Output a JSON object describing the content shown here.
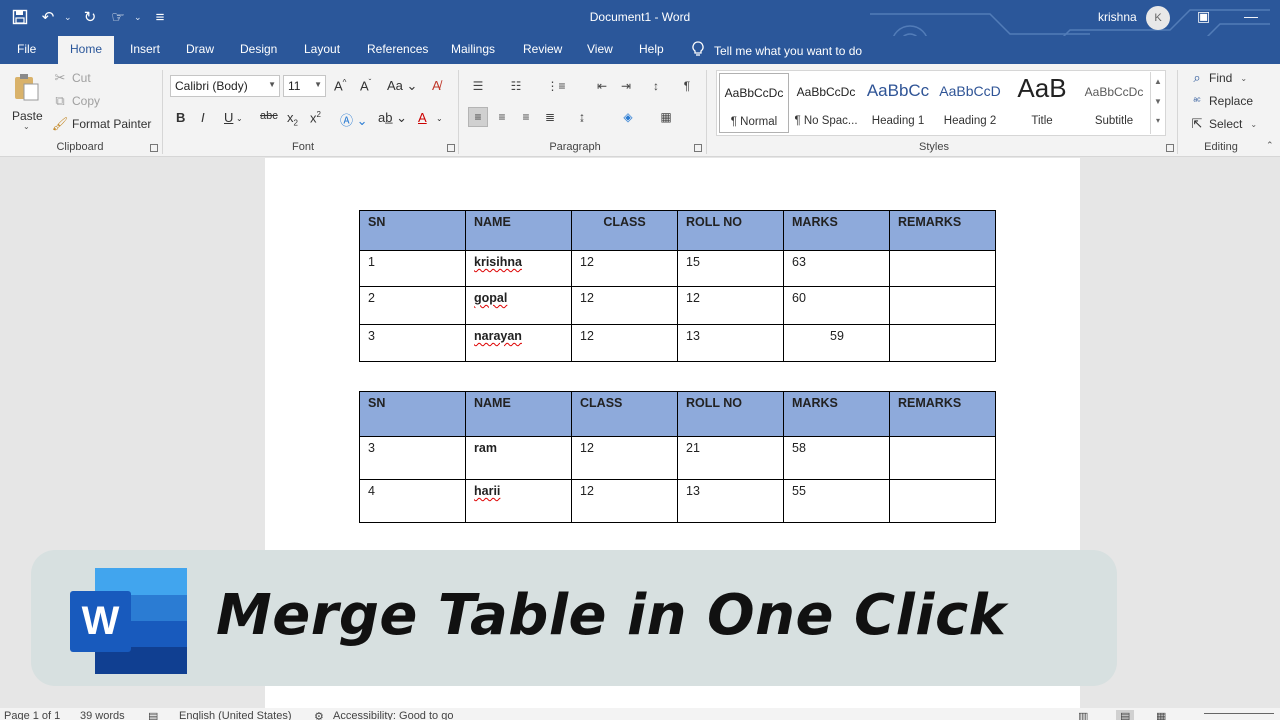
{
  "titlebar": {
    "doc_title": "Document1  -  Word",
    "user_name": "krishna",
    "avatar_initial": "K"
  },
  "tabs": {
    "file": "File",
    "home": "Home",
    "insert": "Insert",
    "draw": "Draw",
    "design": "Design",
    "layout": "Layout",
    "references": "References",
    "mailings": "Mailings",
    "review": "Review",
    "view": "View",
    "help": "Help",
    "tell_me": "Tell me what you want to do"
  },
  "clipboard": {
    "paste": "Paste",
    "cut": "Cut",
    "copy": "Copy",
    "format_painter": "Format Painter",
    "label": "Clipboard"
  },
  "font": {
    "font_name": "Calibri (Body)",
    "font_size": "11",
    "label": "Font"
  },
  "paragraph": {
    "label": "Paragraph"
  },
  "styles": {
    "label": "Styles",
    "items": [
      {
        "preview": "AaBbCcDc",
        "name": "¶ Normal"
      },
      {
        "preview": "AaBbCcDc",
        "name": "¶ No Spac..."
      },
      {
        "preview": "AaBbCc",
        "name": "Heading 1"
      },
      {
        "preview": "AaBbCcD",
        "name": "Heading 2"
      },
      {
        "preview": "AaB",
        "name": "Title"
      },
      {
        "preview": "AaBbCcDc",
        "name": "Subtitle"
      }
    ]
  },
  "editing": {
    "find": "Find",
    "replace": "Replace",
    "select": "Select",
    "label": "Editing"
  },
  "table1": {
    "headers": [
      "SN",
      "NAME",
      "CLASS",
      "ROLL NO",
      "MARKS",
      "REMARKS"
    ],
    "rows": [
      [
        "1",
        "krisihna",
        "12",
        "15",
        "63",
        ""
      ],
      [
        "2",
        "gopal",
        "12",
        "12",
        "60",
        ""
      ],
      [
        "3",
        "narayan",
        "12",
        "13",
        "59",
        ""
      ]
    ]
  },
  "table2": {
    "headers": [
      "SN",
      "NAME",
      "CLASS",
      "ROLL NO",
      "MARKS",
      "REMARKS"
    ],
    "rows": [
      [
        "3",
        "ram",
        "12",
        "21",
        "58",
        ""
      ],
      [
        "4",
        "harii",
        "12",
        "13",
        "55",
        ""
      ]
    ]
  },
  "banner": {
    "logo_letter": "W",
    "title": "Merge Table in One Click"
  },
  "statusbar": {
    "page": "Page 1 of 1",
    "words": "39 words",
    "language": "English (United States)",
    "accessibility": "Accessibility: Good to go"
  },
  "icons": [
    "save-icon",
    "undo-icon",
    "redo-icon",
    "touch-mode-icon",
    "customize-qat-icon",
    "ribbon-display-icon",
    "minimize-icon",
    "lightbulb-icon",
    "paste-icon",
    "cut-icon",
    "copy-icon",
    "format-painter-icon",
    "find-icon",
    "replace-icon",
    "select-icon"
  ]
}
